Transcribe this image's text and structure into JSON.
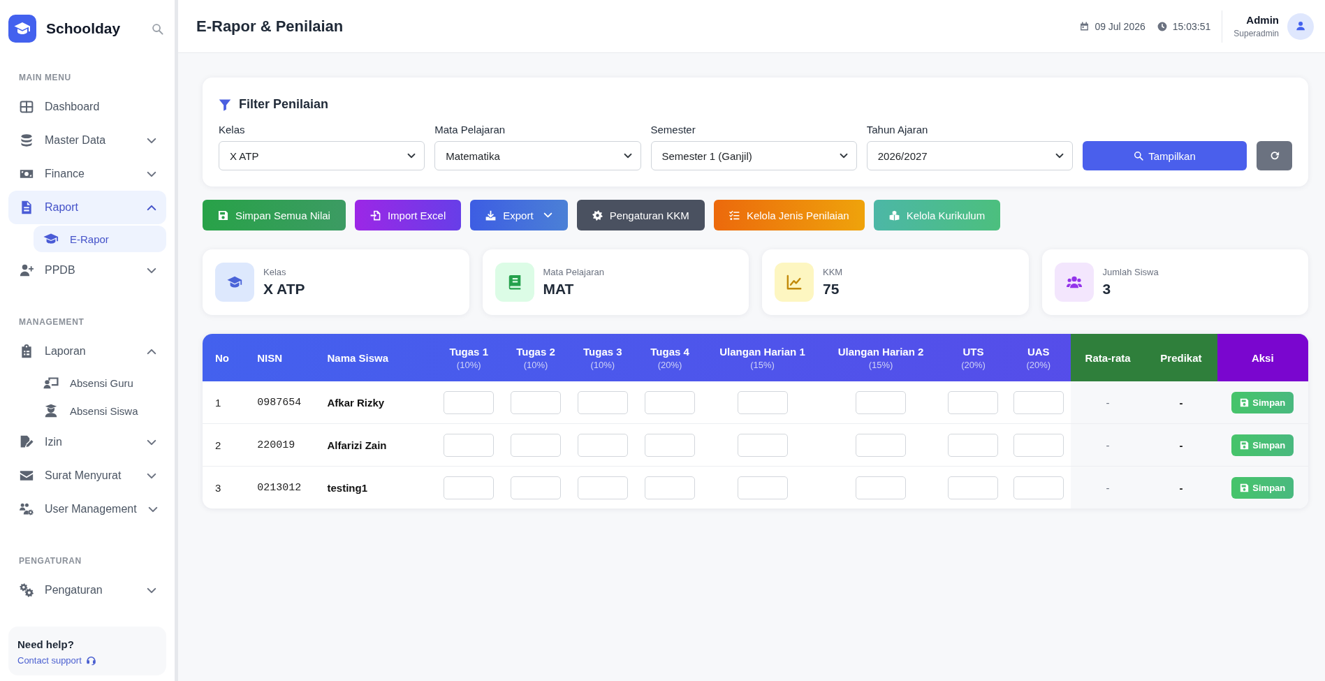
{
  "sidebar": {
    "brand": "Schoolday",
    "sections": [
      {
        "heading": "MAIN MENU",
        "items": [
          {
            "label": "Dashboard",
            "kind": "link",
            "selected": false
          },
          {
            "label": "Master Data",
            "kind": "group",
            "expanded": false,
            "selected": false
          },
          {
            "label": "Finance",
            "kind": "group",
            "expanded": false,
            "selected": false
          },
          {
            "label": "Raport",
            "kind": "group",
            "expanded": true,
            "selected": true,
            "children": [
              {
                "label": "E-Rapor",
                "selected": true
              }
            ]
          },
          {
            "label": "PPDB",
            "kind": "group",
            "expanded": false,
            "selected": false
          }
        ]
      },
      {
        "heading": "MANAGEMENT",
        "items": [
          {
            "label": "Laporan",
            "kind": "group",
            "expanded": true,
            "selected": false,
            "children": [
              {
                "label": "Absensi Guru",
                "selected": false
              },
              {
                "label": "Absensi Siswa",
                "selected": false
              }
            ]
          },
          {
            "label": "Izin",
            "kind": "group",
            "expanded": false,
            "selected": false
          },
          {
            "label": "Surat Menyurat",
            "kind": "group",
            "expanded": false,
            "selected": false
          },
          {
            "label": "User Management",
            "kind": "group",
            "expanded": false,
            "selected": false
          }
        ]
      },
      {
        "heading": "PENGATURAN",
        "items": [
          {
            "label": "Pengaturan",
            "kind": "group",
            "expanded": false,
            "selected": false
          }
        ]
      }
    ],
    "help": {
      "title": "Need help?",
      "link": "Contact support"
    }
  },
  "header": {
    "title": "E-Rapor & Penilaian",
    "date": "09 Jul 2026",
    "time": "15:03:51",
    "user": {
      "name": "Admin",
      "role": "Superadmin"
    }
  },
  "filter": {
    "title": "Filter Penilaian",
    "fields": [
      {
        "label": "Kelas",
        "value": "X ATP"
      },
      {
        "label": "Mata Pelajaran",
        "value": "Matematika"
      },
      {
        "label": "Semester",
        "value": "Semester 1 (Ganjil)"
      },
      {
        "label": "Tahun Ajaran",
        "value": "2026/2027"
      }
    ],
    "submit": "Tampilkan"
  },
  "actions": [
    {
      "label": "Simpan Semua Nilai",
      "kind": "save",
      "dropdown": false
    },
    {
      "label": "Import Excel",
      "kind": "import",
      "dropdown": false
    },
    {
      "label": "Export",
      "kind": "export",
      "dropdown": true
    },
    {
      "label": "Pengaturan KKM",
      "kind": "settings",
      "dropdown": false
    },
    {
      "label": "Kelola Jenis Penilaian",
      "kind": "types",
      "dropdown": false
    },
    {
      "label": "Kelola Kurikulum",
      "kind": "curriculum",
      "dropdown": false
    }
  ],
  "stats": [
    {
      "label": "Kelas",
      "value": "X ATP",
      "kind": "class"
    },
    {
      "label": "Mata Pelajaran",
      "value": "MAT",
      "kind": "subject"
    },
    {
      "label": "KKM",
      "value": "75",
      "kind": "kkm"
    },
    {
      "label": "Jumlah Siswa",
      "value": "3",
      "kind": "students"
    }
  ],
  "table": {
    "columns": [
      {
        "title": "No",
        "kind": "number"
      },
      {
        "title": "NISN",
        "kind": "code"
      },
      {
        "title": "Nama Siswa",
        "kind": "name"
      },
      {
        "title": "Tugas 1",
        "weight": "(10%)",
        "kind": "score"
      },
      {
        "title": "Tugas 2",
        "weight": "(10%)",
        "kind": "score"
      },
      {
        "title": "Tugas 3",
        "weight": "(10%)",
        "kind": "score"
      },
      {
        "title": "Tugas 4",
        "weight": "(20%)",
        "kind": "score"
      },
      {
        "title": "Ulangan Harian 1",
        "weight": "(15%)",
        "kind": "score"
      },
      {
        "title": "Ulangan Harian 2",
        "weight": "(15%)",
        "kind": "score"
      },
      {
        "title": "UTS",
        "weight": "(20%)",
        "kind": "score"
      },
      {
        "title": "UAS",
        "weight": "(20%)",
        "kind": "score"
      },
      {
        "title": "Rata-rata",
        "kind": "average"
      },
      {
        "title": "Predikat",
        "kind": "grade"
      },
      {
        "title": "Aksi",
        "kind": "action"
      }
    ],
    "rows": [
      {
        "no": "1",
        "nisn": "0987654",
        "name": "Afkar Rizky",
        "average": "-",
        "grade": "-",
        "action": "Simpan"
      },
      {
        "no": "2",
        "nisn": "220019",
        "name": "Alfarizi Zain",
        "average": "-",
        "grade": "-",
        "action": "Simpan"
      },
      {
        "no": "3",
        "nisn": "0213012",
        "name": "testing1",
        "average": "-",
        "grade": "-",
        "action": "Simpan"
      }
    ]
  }
}
